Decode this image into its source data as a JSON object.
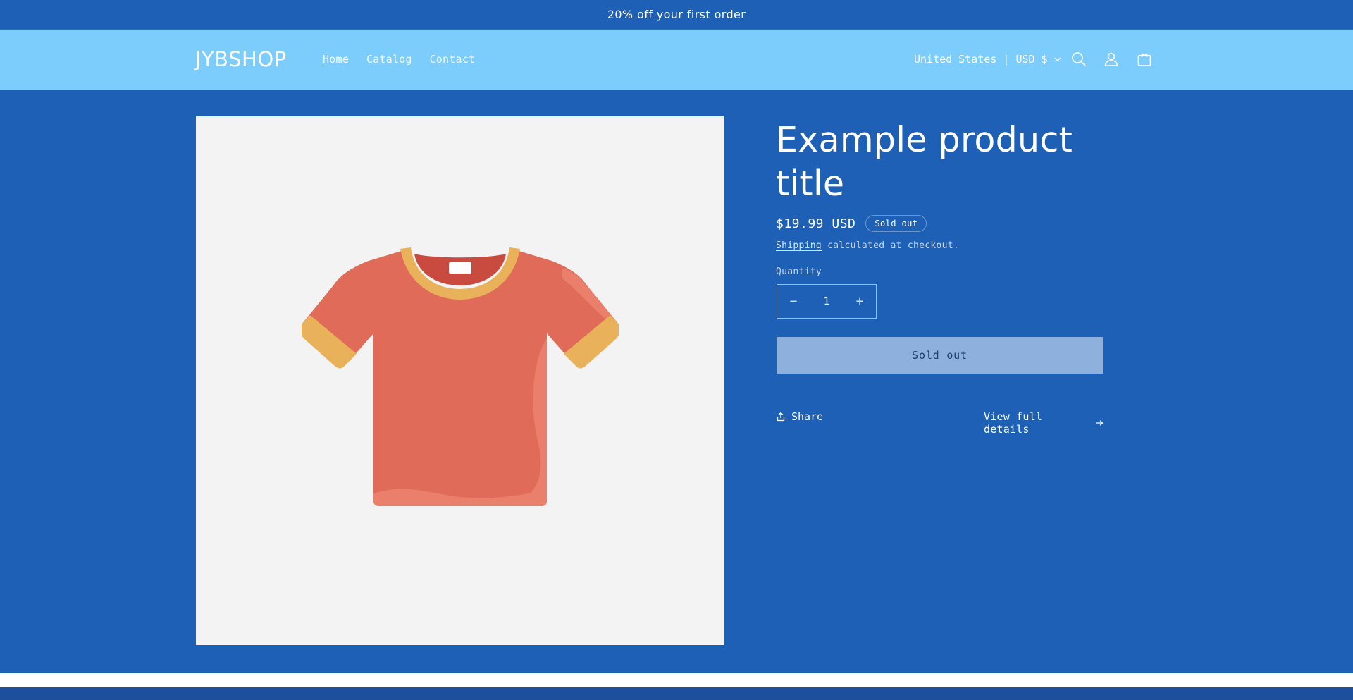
{
  "announcement": {
    "text": "20% off your first order"
  },
  "header": {
    "logo": "JYBSHOP",
    "nav": [
      {
        "label": "Home",
        "active": true
      },
      {
        "label": "Catalog",
        "active": false
      },
      {
        "label": "Contact",
        "active": false
      }
    ],
    "localization": "United States | USD $",
    "icons": [
      "search-icon",
      "account-icon",
      "cart-icon"
    ]
  },
  "product": {
    "image_icon": "t-shirt",
    "title": "Example product title",
    "price": "$19.99 USD",
    "badge": "Sold out",
    "shipping_link": "Shipping",
    "shipping_text": " calculated at checkout.",
    "quantity_label": "Quantity",
    "quantity_value": "1",
    "sold_out_button": "Sold out",
    "share_label": "Share",
    "details_link": "View full details"
  },
  "colors": {
    "page_background": "#1d60b6",
    "header_background": "#7ccdfc",
    "media_background": "#f3f3f3",
    "button_disabled": "#8eb0dc",
    "shirt_body": "#e06b59",
    "shirt_trim": "#e9b15a"
  }
}
